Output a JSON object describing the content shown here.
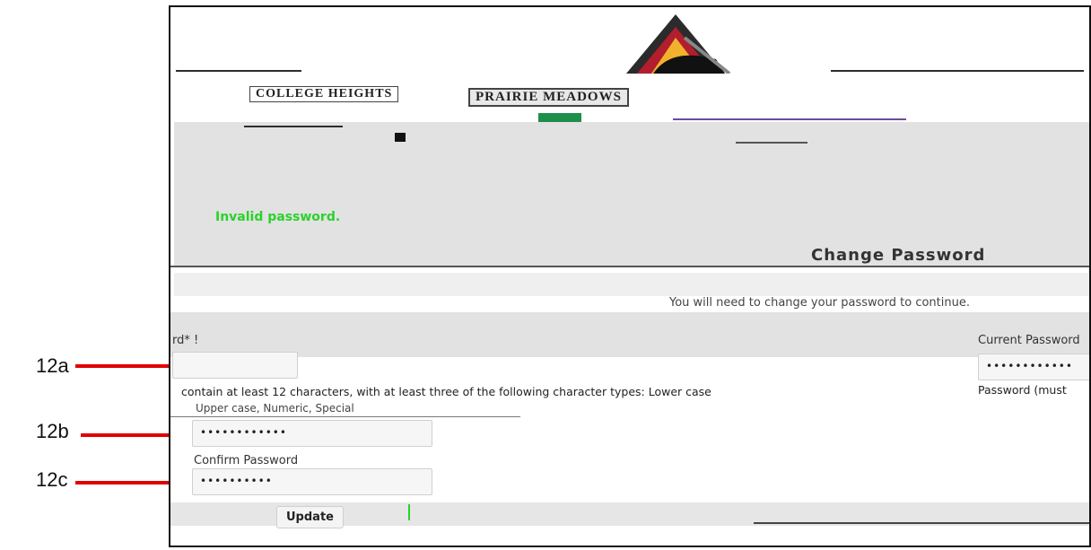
{
  "annotations": {
    "a": "12a",
    "b": "12b",
    "c": "12c"
  },
  "banner": {
    "left_school": "COLLEGE HEIGHTS",
    "right_school": "PRAIRIE MEADOWS"
  },
  "status_message": "Invalid password.",
  "heading": "Change Password",
  "subheading": "You will need to change your password to continue.",
  "form": {
    "current_password": {
      "label": "Current Password",
      "value": "••••••••••••"
    },
    "new_password": {
      "label_fragment": "rd* !",
      "requirements_line1": "contain at least 12 characters, with at least three of the following character types: Lower case",
      "requirements_line2": "Upper case, Numeric, Special",
      "right_label_fragment": "Password (must",
      "value": "••••••••••••"
    },
    "confirm_password": {
      "label": "Confirm Password",
      "value": "••••••••••"
    },
    "update_button": "Update"
  },
  "colors": {
    "accent_red": "#e00000",
    "success_green": "#2ad22a"
  }
}
